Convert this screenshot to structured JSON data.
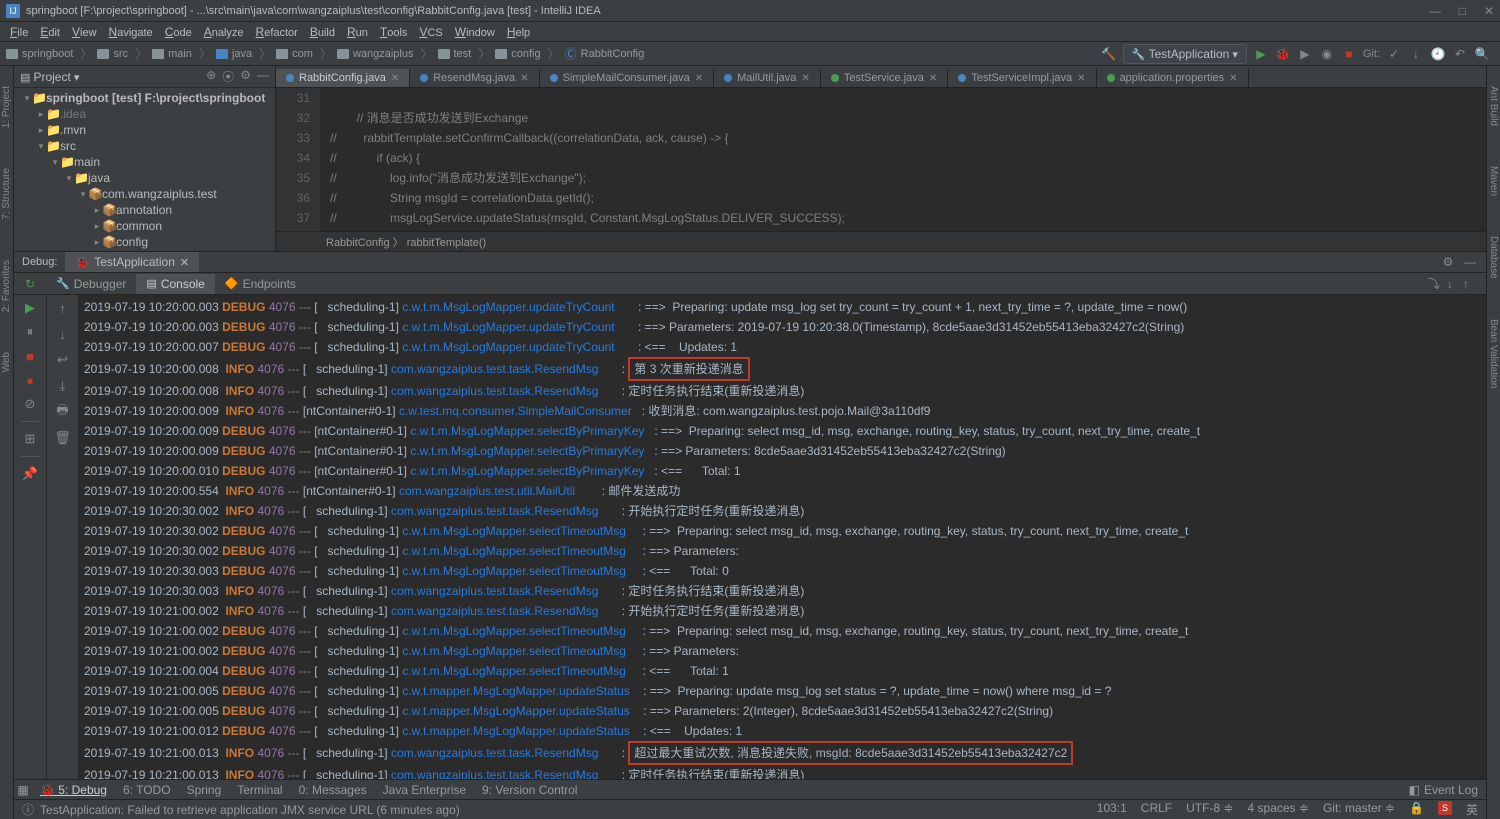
{
  "window": {
    "title": "springboot [F:\\project\\springboot] - ...\\src\\main\\java\\com\\wangzaiplus\\test\\config\\RabbitConfig.java [test] - IntelliJ IDEA",
    "minimize": "—",
    "maximize": "□",
    "close": "✕"
  },
  "menu": [
    "File",
    "Edit",
    "View",
    "Navigate",
    "Code",
    "Analyze",
    "Refactor",
    "Build",
    "Run",
    "Tools",
    "VCS",
    "Window",
    "Help"
  ],
  "breadcrumbs": [
    "springboot",
    "src",
    "main",
    "java",
    "com",
    "wangzaiplus",
    "test",
    "config",
    "RabbitConfig"
  ],
  "runConfig": "TestApplication",
  "gitLabel": "Git:",
  "projectPanel": {
    "title": "Project",
    "tree": [
      {
        "depth": 0,
        "arrow": "▾",
        "icon": "📁",
        "label": "springboot [test]  F:\\project\\springboot",
        "bold": true
      },
      {
        "depth": 1,
        "arrow": "▸",
        "icon": "📁",
        "label": ".idea",
        "dim": true
      },
      {
        "depth": 1,
        "arrow": "▸",
        "icon": "📁",
        "label": ".mvn"
      },
      {
        "depth": 1,
        "arrow": "▾",
        "icon": "📁",
        "label": "src"
      },
      {
        "depth": 2,
        "arrow": "▾",
        "icon": "📁",
        "label": "main"
      },
      {
        "depth": 3,
        "arrow": "▾",
        "icon": "📁",
        "label": "java",
        "blue": true
      },
      {
        "depth": 4,
        "arrow": "▾",
        "icon": "📦",
        "label": "com.wangzaiplus.test"
      },
      {
        "depth": 5,
        "arrow": "▸",
        "icon": "📦",
        "label": "annotation"
      },
      {
        "depth": 5,
        "arrow": "▸",
        "icon": "📦",
        "label": "common"
      },
      {
        "depth": 5,
        "arrow": "▸",
        "icon": "📦",
        "label": "config"
      }
    ]
  },
  "editorTabs": [
    {
      "label": "RabbitConfig.java",
      "active": true,
      "color": "blue"
    },
    {
      "label": "ResendMsg.java",
      "color": "blue"
    },
    {
      "label": "SimpleMailConsumer.java",
      "color": "blue"
    },
    {
      "label": "MailUtil.java",
      "color": "blue"
    },
    {
      "label": "TestService.java",
      "color": "green"
    },
    {
      "label": "TestServiceImpl.java",
      "color": "blue"
    },
    {
      "label": "application.properties",
      "color": "green"
    }
  ],
  "code": {
    "start": 31,
    "lines": [
      "",
      "        // 消息是否成功发送到Exchange",
      "//        rabbitTemplate.setConfirmCallback((correlationData, ack, cause) -> {",
      "//            if (ack) {",
      "//                log.info(\"消息成功发送到Exchange\");",
      "//                String msgId = correlationData.getId();",
      "//                msgLogService.updateStatus(msgId, Constant.MsgLogStatus.DELIVER_SUCCESS);"
    ],
    "breadcrumb": "RabbitConfig 〉 rabbitTemplate()"
  },
  "debugTab": "TestApplication",
  "debugLabel": "Debug:",
  "consoleTabs": {
    "debugger": "Debugger",
    "console": "Console",
    "endpoints": "Endpoints"
  },
  "logs": [
    {
      "ts": "2019-07-19 10:20:00.003",
      "lvl": "DEBUG",
      "pid": "4076",
      "thread": "[   scheduling-1]",
      "cls": "c.w.t.m.MsgLogMapper.updateTryCount      ",
      "msg": ": ==>  Preparing: update msg_log set try_count = try_count + 1, next_try_time = ?, update_time = now()"
    },
    {
      "ts": "2019-07-19 10:20:00.003",
      "lvl": "DEBUG",
      "pid": "4076",
      "thread": "[   scheduling-1]",
      "cls": "c.w.t.m.MsgLogMapper.updateTryCount      ",
      "msg": ": ==> Parameters: 2019-07-19 10:20:38.0(Timestamp), 8cde5aae3d31452eb55413eba32427c2(String)"
    },
    {
      "ts": "2019-07-19 10:20:00.007",
      "lvl": "DEBUG",
      "pid": "4076",
      "thread": "[   scheduling-1]",
      "cls": "c.w.t.m.MsgLogMapper.updateTryCount      ",
      "msg": ": <==    Updates: 1"
    },
    {
      "ts": "2019-07-19 10:20:00.008",
      "lvl": " INFO",
      "pid": "4076",
      "thread": "[   scheduling-1]",
      "cls": "com.wangzaiplus.test.task.ResendMsg      ",
      "msg": ": ",
      "box": "第 3 次重新投递消息"
    },
    {
      "ts": "2019-07-19 10:20:00.008",
      "lvl": " INFO",
      "pid": "4076",
      "thread": "[   scheduling-1]",
      "cls": "com.wangzaiplus.test.task.ResendMsg      ",
      "msg": ": 定时任务执行结束(重新投递消息)"
    },
    {
      "ts": "2019-07-19 10:20:00.009",
      "lvl": " INFO",
      "pid": "4076",
      "thread": "[ntContainer#0-1]",
      "cls": "c.w.test.mq.consumer.SimpleMailConsumer  ",
      "msg": ": 收到消息: com.wangzaiplus.test.pojo.Mail@3a110df9"
    },
    {
      "ts": "2019-07-19 10:20:00.009",
      "lvl": "DEBUG",
      "pid": "4076",
      "thread": "[ntContainer#0-1]",
      "cls": "c.w.t.m.MsgLogMapper.selectByPrimaryKey  ",
      "msg": ": ==>  Preparing: select msg_id, msg, exchange, routing_key, status, try_count, next_try_time, create_t"
    },
    {
      "ts": "2019-07-19 10:20:00.009",
      "lvl": "DEBUG",
      "pid": "4076",
      "thread": "[ntContainer#0-1]",
      "cls": "c.w.t.m.MsgLogMapper.selectByPrimaryKey  ",
      "msg": ": ==> Parameters: 8cde5aae3d31452eb55413eba32427c2(String)"
    },
    {
      "ts": "2019-07-19 10:20:00.010",
      "lvl": "DEBUG",
      "pid": "4076",
      "thread": "[ntContainer#0-1]",
      "cls": "c.w.t.m.MsgLogMapper.selectByPrimaryKey  ",
      "msg": ": <==      Total: 1"
    },
    {
      "ts": "2019-07-19 10:20:00.554",
      "lvl": " INFO",
      "pid": "4076",
      "thread": "[ntContainer#0-1]",
      "cls": "com.wangzaiplus.test.util.MailUtil       ",
      "msg": ": 邮件发送成功"
    },
    {
      "ts": "2019-07-19 10:20:30.002",
      "lvl": " INFO",
      "pid": "4076",
      "thread": "[   scheduling-1]",
      "cls": "com.wangzaiplus.test.task.ResendMsg      ",
      "msg": ": 开始执行定时任务(重新投递消息)"
    },
    {
      "ts": "2019-07-19 10:20:30.002",
      "lvl": "DEBUG",
      "pid": "4076",
      "thread": "[   scheduling-1]",
      "cls": "c.w.t.m.MsgLogMapper.selectTimeoutMsg    ",
      "msg": ": ==>  Preparing: select msg_id, msg, exchange, routing_key, status, try_count, next_try_time, create_t"
    },
    {
      "ts": "2019-07-19 10:20:30.002",
      "lvl": "DEBUG",
      "pid": "4076",
      "thread": "[   scheduling-1]",
      "cls": "c.w.t.m.MsgLogMapper.selectTimeoutMsg    ",
      "msg": ": ==> Parameters: "
    },
    {
      "ts": "2019-07-19 10:20:30.003",
      "lvl": "DEBUG",
      "pid": "4076",
      "thread": "[   scheduling-1]",
      "cls": "c.w.t.m.MsgLogMapper.selectTimeoutMsg    ",
      "msg": ": <==      Total: 0"
    },
    {
      "ts": "2019-07-19 10:20:30.003",
      "lvl": " INFO",
      "pid": "4076",
      "thread": "[   scheduling-1]",
      "cls": "com.wangzaiplus.test.task.ResendMsg      ",
      "msg": ": 定时任务执行结束(重新投递消息)"
    },
    {
      "ts": "2019-07-19 10:21:00.002",
      "lvl": " INFO",
      "pid": "4076",
      "thread": "[   scheduling-1]",
      "cls": "com.wangzaiplus.test.task.ResendMsg      ",
      "msg": ": 开始执行定时任务(重新投递消息)"
    },
    {
      "ts": "2019-07-19 10:21:00.002",
      "lvl": "DEBUG",
      "pid": "4076",
      "thread": "[   scheduling-1]",
      "cls": "c.w.t.m.MsgLogMapper.selectTimeoutMsg    ",
      "msg": ": ==>  Preparing: select msg_id, msg, exchange, routing_key, status, try_count, next_try_time, create_t"
    },
    {
      "ts": "2019-07-19 10:21:00.002",
      "lvl": "DEBUG",
      "pid": "4076",
      "thread": "[   scheduling-1]",
      "cls": "c.w.t.m.MsgLogMapper.selectTimeoutMsg    ",
      "msg": ": ==> Parameters: "
    },
    {
      "ts": "2019-07-19 10:21:00.004",
      "lvl": "DEBUG",
      "pid": "4076",
      "thread": "[   scheduling-1]",
      "cls": "c.w.t.m.MsgLogMapper.selectTimeoutMsg    ",
      "msg": ": <==      Total: 1"
    },
    {
      "ts": "2019-07-19 10:21:00.005",
      "lvl": "DEBUG",
      "pid": "4076",
      "thread": "[   scheduling-1]",
      "cls": "c.w.t.mapper.MsgLogMapper.updateStatus   ",
      "msg": ": ==>  Preparing: update msg_log set status = ?, update_time = now() where msg_id = ? "
    },
    {
      "ts": "2019-07-19 10:21:00.005",
      "lvl": "DEBUG",
      "pid": "4076",
      "thread": "[   scheduling-1]",
      "cls": "c.w.t.mapper.MsgLogMapper.updateStatus   ",
      "msg": ": ==> Parameters: 2(Integer), 8cde5aae3d31452eb55413eba32427c2(String)"
    },
    {
      "ts": "2019-07-19 10:21:00.012",
      "lvl": "DEBUG",
      "pid": "4076",
      "thread": "[   scheduling-1]",
      "cls": "c.w.t.mapper.MsgLogMapper.updateStatus   ",
      "msg": ": <==    Updates: 1"
    },
    {
      "ts": "2019-07-19 10:21:00.013",
      "lvl": " INFO",
      "pid": "4076",
      "thread": "[   scheduling-1]",
      "cls": "com.wangzaiplus.test.task.ResendMsg      ",
      "msg": ": ",
      "box": "超过最大重试次数, 消息投递失败, msgId: 8cde5aae3d31452eb55413eba32427c2"
    },
    {
      "ts": "2019-07-19 10:21:00.013",
      "lvl": " INFO",
      "pid": "4076",
      "thread": "[   scheduling-1]",
      "cls": "com.wangzaiplus.test.task.ResendMsg      ",
      "msg": ": 定时任务执行结束(重新投递消息)"
    }
  ],
  "bottomTabs": [
    "5: Debug",
    "6: TODO",
    "Spring",
    "Terminal",
    "0: Messages",
    "Java Enterprise",
    "9: Version Control"
  ],
  "eventLog": "Event Log",
  "status": {
    "msg": "TestApplication: Failed to retrieve application JMX service URL (6 minutes ago)",
    "pos": "103:1",
    "eol": "CRLF",
    "enc": "UTF-8",
    "indent": "4 spaces",
    "branch": "Git: master"
  },
  "leftTools": [
    "1: Project",
    "7: Structure"
  ],
  "rightTools": [
    "Ant Build",
    "Maven",
    "Database",
    "Bean Validation"
  ],
  "bottomLeft": [
    "2: Favorites",
    "Web"
  ]
}
